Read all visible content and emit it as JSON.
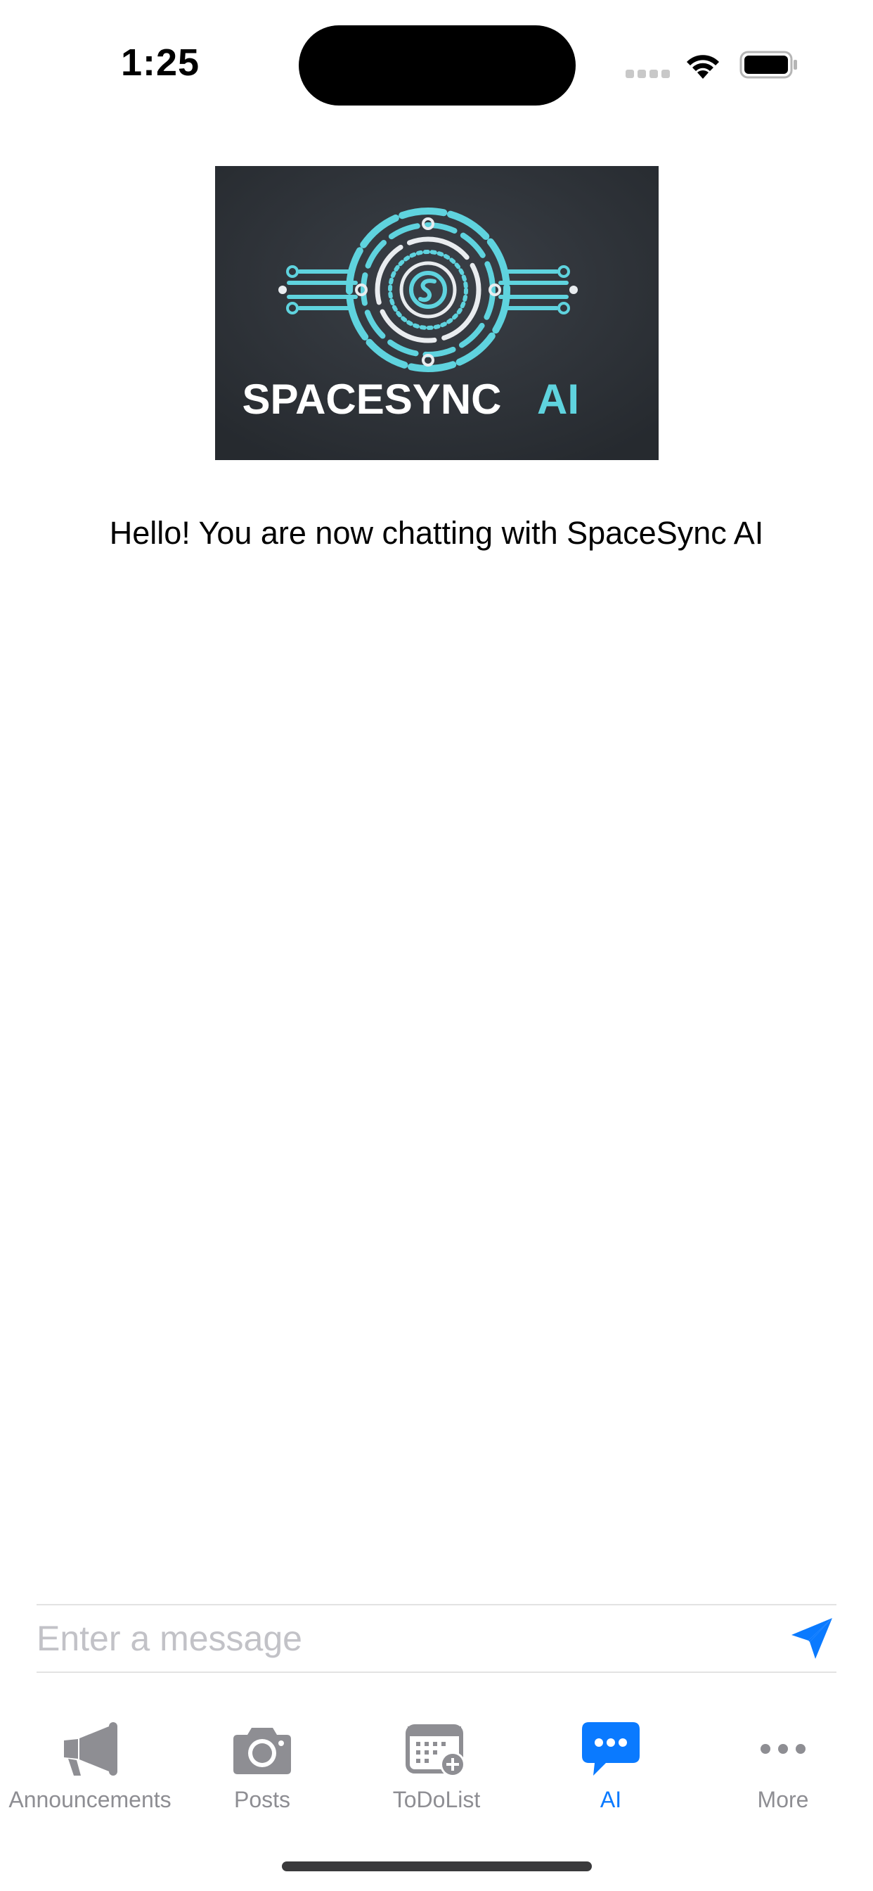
{
  "status_bar": {
    "time": "1:25"
  },
  "logo": {
    "brand_main": "SPACESYNC",
    "brand_suffix": "AI",
    "colors": {
      "accent": "#5fd3de",
      "background": "#2f3338"
    }
  },
  "chat": {
    "greeting": "Hello! You are now chatting with SpaceSync AI"
  },
  "composer": {
    "placeholder": "Enter a message",
    "value": ""
  },
  "tab_bar": {
    "items": [
      {
        "label": "Announcements",
        "icon": "megaphone-icon",
        "active": false
      },
      {
        "label": "Posts",
        "icon": "camera-icon",
        "active": false
      },
      {
        "label": "ToDoList",
        "icon": "calendar-add-icon",
        "active": false
      },
      {
        "label": "AI",
        "icon": "chat-bubble-icon",
        "active": true
      },
      {
        "label": "More",
        "icon": "more-icon",
        "active": false
      }
    ]
  },
  "colors": {
    "active": "#0a7aff",
    "inactive": "#8e8e93"
  }
}
